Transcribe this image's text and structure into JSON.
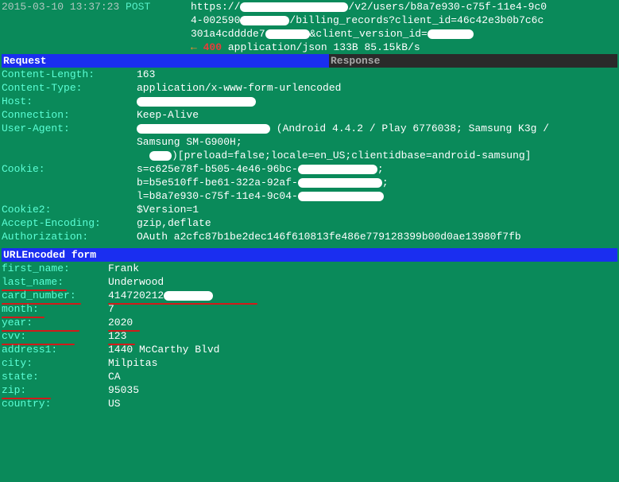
{
  "top": {
    "timestamp": "2015-03-10 13:37:23",
    "method": "POST",
    "url1_pre": "https://",
    "url1_post": "/v2/users/b8a7e930-c75f-11e4-9c0",
    "url2_pre": "4-002590",
    "url2_post": "/billing_records?client_id=46c42e3b0b7c6c",
    "url3_pre": "301a4cdddde7",
    "url3_mid": "&client_version_id=",
    "arrow": "←",
    "status": "400",
    "resp_line": "application/json 133B 85.15kB/s"
  },
  "tabs": {
    "request": "Request",
    "response": "Response"
  },
  "headers": {
    "content_length": {
      "k": "Content-Length:",
      "v": "163"
    },
    "content_type": {
      "k": "Content-Type:",
      "v": "application/x-www-form-urlencoded"
    },
    "host": {
      "k": "Host:",
      "v": ""
    },
    "connection": {
      "k": "Connection:",
      "v": "Keep-Alive"
    },
    "user_agent": {
      "k": "User-Agent:",
      "v1_suffix": " (Android 4.4.2 / Play 6776038; Samsung K3g /",
      "v2": "Samsung SM-G900H;",
      "v3": ")[preload=false;locale=en_US;clientidbase=android-samsung]"
    },
    "cookie": {
      "k": "Cookie:",
      "s": "s=c625e78f-b505-4e46-96bc-",
      "b": "b=b5e510ff-be61-322a-92af-",
      "l": "l=b8a7e930-c75f-11e4-9c04-",
      "semi": ";"
    },
    "cookie2": {
      "k": "Cookie2:",
      "v": "$Version=1"
    },
    "accept_encoding": {
      "k": "Accept-Encoding:",
      "v": "gzip,deflate"
    },
    "authorization": {
      "k": "Authorization:",
      "v": "OAuth a2cfc87b1be2dec146f610813fe486e779128399b00d0ae13980f7fb"
    }
  },
  "section": "URLEncoded form",
  "form": {
    "first_name": {
      "k": "first_name:",
      "v": "Frank"
    },
    "last_name": {
      "k": "last_name:",
      "v": "Underwood"
    },
    "card_number": {
      "k": "card_number:",
      "v": "414720212"
    },
    "month": {
      "k": "month:",
      "v": "7"
    },
    "year": {
      "k": "year:",
      "v": "2020"
    },
    "cvv": {
      "k": "cvv:",
      "v": "123"
    },
    "address1": {
      "k": "address1:",
      "v": "1440 McCarthy Blvd"
    },
    "city": {
      "k": "city:",
      "v": "Milpitas"
    },
    "state": {
      "k": "state:",
      "v": "CA"
    },
    "zip": {
      "k": "zip:",
      "v": "95035"
    },
    "country": {
      "k": "country:",
      "v": "US"
    }
  }
}
